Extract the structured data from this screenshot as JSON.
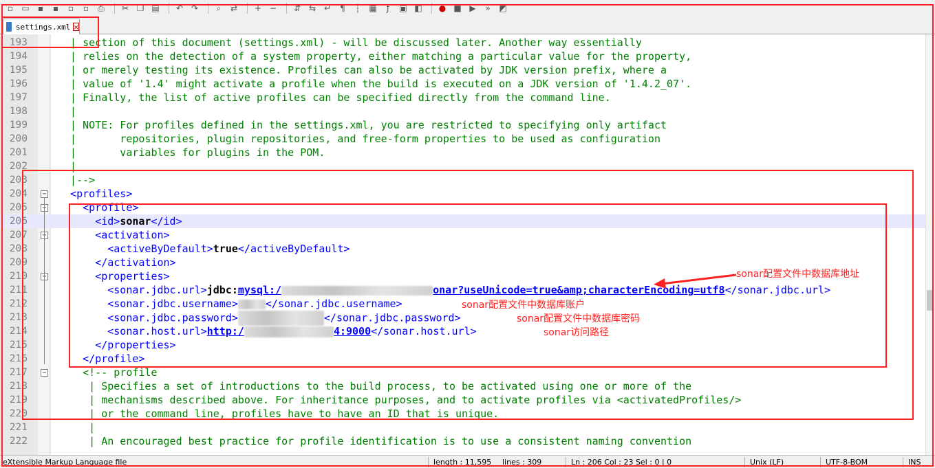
{
  "toolbar": {
    "buttons": [
      "new-icon",
      "open-icon",
      "save-icon",
      "save-all-icon",
      "close-icon",
      "close-all-icon",
      "print-icon",
      "cut-icon",
      "copy-icon",
      "paste-icon",
      "undo-icon",
      "redo-icon",
      "find-icon",
      "replace-icon",
      "zoom-in-icon",
      "zoom-out-icon",
      "sync-v-icon",
      "sync-h-icon",
      "wrap-icon",
      "all-chars-icon",
      "indent-guide-icon",
      "doc-map-icon",
      "function-list-icon",
      "folder-icon",
      "monitor-icon",
      "record-icon",
      "stop-icon",
      "play-icon",
      "run-multi-icon",
      "save-macro-icon"
    ]
  },
  "tab": {
    "label": "settings.xml",
    "close": "✕"
  },
  "lines": [
    {
      "num": "193",
      "text": "  | section of this document (settings.xml) - will be discussed later. Another way essentially"
    },
    {
      "num": "194",
      "text": "  | relies on the detection of a system property, either matching a particular value for the property,"
    },
    {
      "num": "195",
      "text": "  | or merely testing its existence. Profiles can also be activated by JDK version prefix, where a"
    },
    {
      "num": "196",
      "text": "  | value of '1.4' might activate a profile when the build is executed on a JDK version of '1.4.2_07'."
    },
    {
      "num": "197",
      "text": "  | Finally, the list of active profiles can be specified directly from the command line."
    },
    {
      "num": "198",
      "text": "  |"
    },
    {
      "num": "199",
      "text": "  | NOTE: For profiles defined in the settings.xml, you are restricted to specifying only artifact"
    },
    {
      "num": "200",
      "text": "  |       repositories, plugin repositories, and free-form properties to be used as configuration"
    },
    {
      "num": "201",
      "text": "  |       variables for plugins in the POM."
    },
    {
      "num": "202",
      "text": "  |"
    },
    {
      "num": "203",
      "text": "  |-->"
    },
    {
      "num": "204",
      "tag": "<profiles>",
      "indent": "  "
    },
    {
      "num": "205",
      "tag": "<profile>",
      "indent": "    "
    },
    {
      "num": "206",
      "open": "<id>",
      "value": "sonar",
      "close": "</id>",
      "indent": "      "
    },
    {
      "num": "207",
      "tag": "<activation>",
      "indent": "      "
    },
    {
      "num": "208",
      "open": "<activeByDefault>",
      "value": "true",
      "close": "</activeByDefault>",
      "indent": "        "
    },
    {
      "num": "209",
      "tag": "</activation>",
      "indent": "      "
    },
    {
      "num": "210",
      "tag": "<properties>",
      "indent": "      "
    },
    {
      "num": "211",
      "open": "<sonar.jdbc.url>",
      "value_a": "jdbc:",
      "value_b": "mysql:/",
      "value_c": "onar?useUnicode=true&amp;characterEncoding=utf8",
      "close": "</sonar.jdbc.url>",
      "indent": "        "
    },
    {
      "num": "212",
      "open": "<sonar.jdbc.username>",
      "close": "</sonar.jdbc.username>",
      "indent": "        "
    },
    {
      "num": "213",
      "open": "<sonar.jdbc.password>",
      "close": "</sonar.jdbc.password>",
      "indent": "        "
    },
    {
      "num": "214",
      "open": "<sonar.host.url>",
      "value_a": "http:/",
      "value_c": "4:9000",
      "close": "</sonar.host.url>",
      "indent": "        "
    },
    {
      "num": "215",
      "tag": "</properties>",
      "indent": "      "
    },
    {
      "num": "216",
      "tag": "</profile>",
      "indent": "    "
    },
    {
      "num": "217",
      "text": "    <!-- profile"
    },
    {
      "num": "218",
      "text": "     | Specifies a set of introductions to the build process, to be activated using one or more of the"
    },
    {
      "num": "219",
      "text": "     | mechanisms described above. For inheritance purposes, and to activate profiles via <activatedProfiles/>"
    },
    {
      "num": "220",
      "text": "     | or the command line, profiles have to have an ID that is unique."
    },
    {
      "num": "221",
      "text": "     |"
    },
    {
      "num": "222",
      "text": "     | An encouraged best practice for profile identification is to use a consistent naming convention"
    }
  ],
  "annotations": {
    "url_note": "sonar配置文件中数据库地址",
    "username_note": "sonar配置文件中数据库账户",
    "password_note": "sonar配置文件中数据库密码",
    "host_note": "sonar访问路径"
  },
  "status": {
    "file_type": "eXtensible Markup Language file",
    "length": "length : 11,595",
    "lines": "lines : 309",
    "position": "Ln : 206    Col : 23    Sel : 0 | 0",
    "eol": "Unix (LF)",
    "encoding": "UTF-8-BOM",
    "mode": "INS"
  },
  "colors": {
    "tag": "#0000ff",
    "comment": "#008000",
    "annotation": "#ff2020",
    "current_line": "#e8e8ff"
  }
}
